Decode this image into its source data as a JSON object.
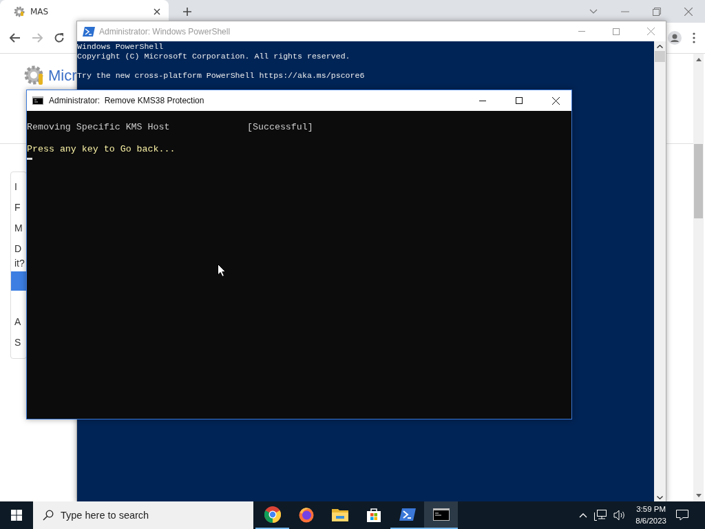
{
  "browser": {
    "tab": {
      "title": "MAS"
    },
    "page": {
      "logo_text": "Micr",
      "menu_items": [
        {
          "label": "I",
          "selected": false
        },
        {
          "label": "F",
          "selected": false
        },
        {
          "label": "M",
          "selected": false
        },
        {
          "label": "D",
          "continuation": "it?",
          "selected": false
        },
        {
          "selected": true
        },
        {
          "label": "A",
          "selected": false
        },
        {
          "label": "S",
          "selected": false
        }
      ]
    }
  },
  "powershell": {
    "title": "Administrator: Windows PowerShell",
    "active": false,
    "paragraphs": [
      [
        "Windows PowerShell",
        "Copyright (C) Microsoft Corporation. All rights reserved."
      ],
      [
        "Try the new cross-platform PowerShell https://aka.ms/pscore6"
      ]
    ]
  },
  "cmd": {
    "title": "Administrator:  Remove KMS38 Protection",
    "active": true,
    "results": [
      {
        "text": "Removing Specific KMS Host",
        "status": "[Successful]"
      }
    ],
    "prompt": "Press any key to Go back..."
  },
  "taskbar": {
    "search": {
      "placeholder": "Type here to search"
    },
    "apps": [
      {
        "kind": "chrome",
        "running": true,
        "selected": false
      },
      {
        "kind": "firefox",
        "running": false,
        "selected": false
      },
      {
        "kind": "explorer",
        "running": false,
        "selected": false
      },
      {
        "kind": "store",
        "running": false,
        "selected": false
      },
      {
        "kind": "powershell",
        "running": true,
        "selected": false
      },
      {
        "kind": "cmd",
        "running": true,
        "selected": true
      }
    ],
    "time": "3:59 PM",
    "date": "8/6/2023"
  }
}
